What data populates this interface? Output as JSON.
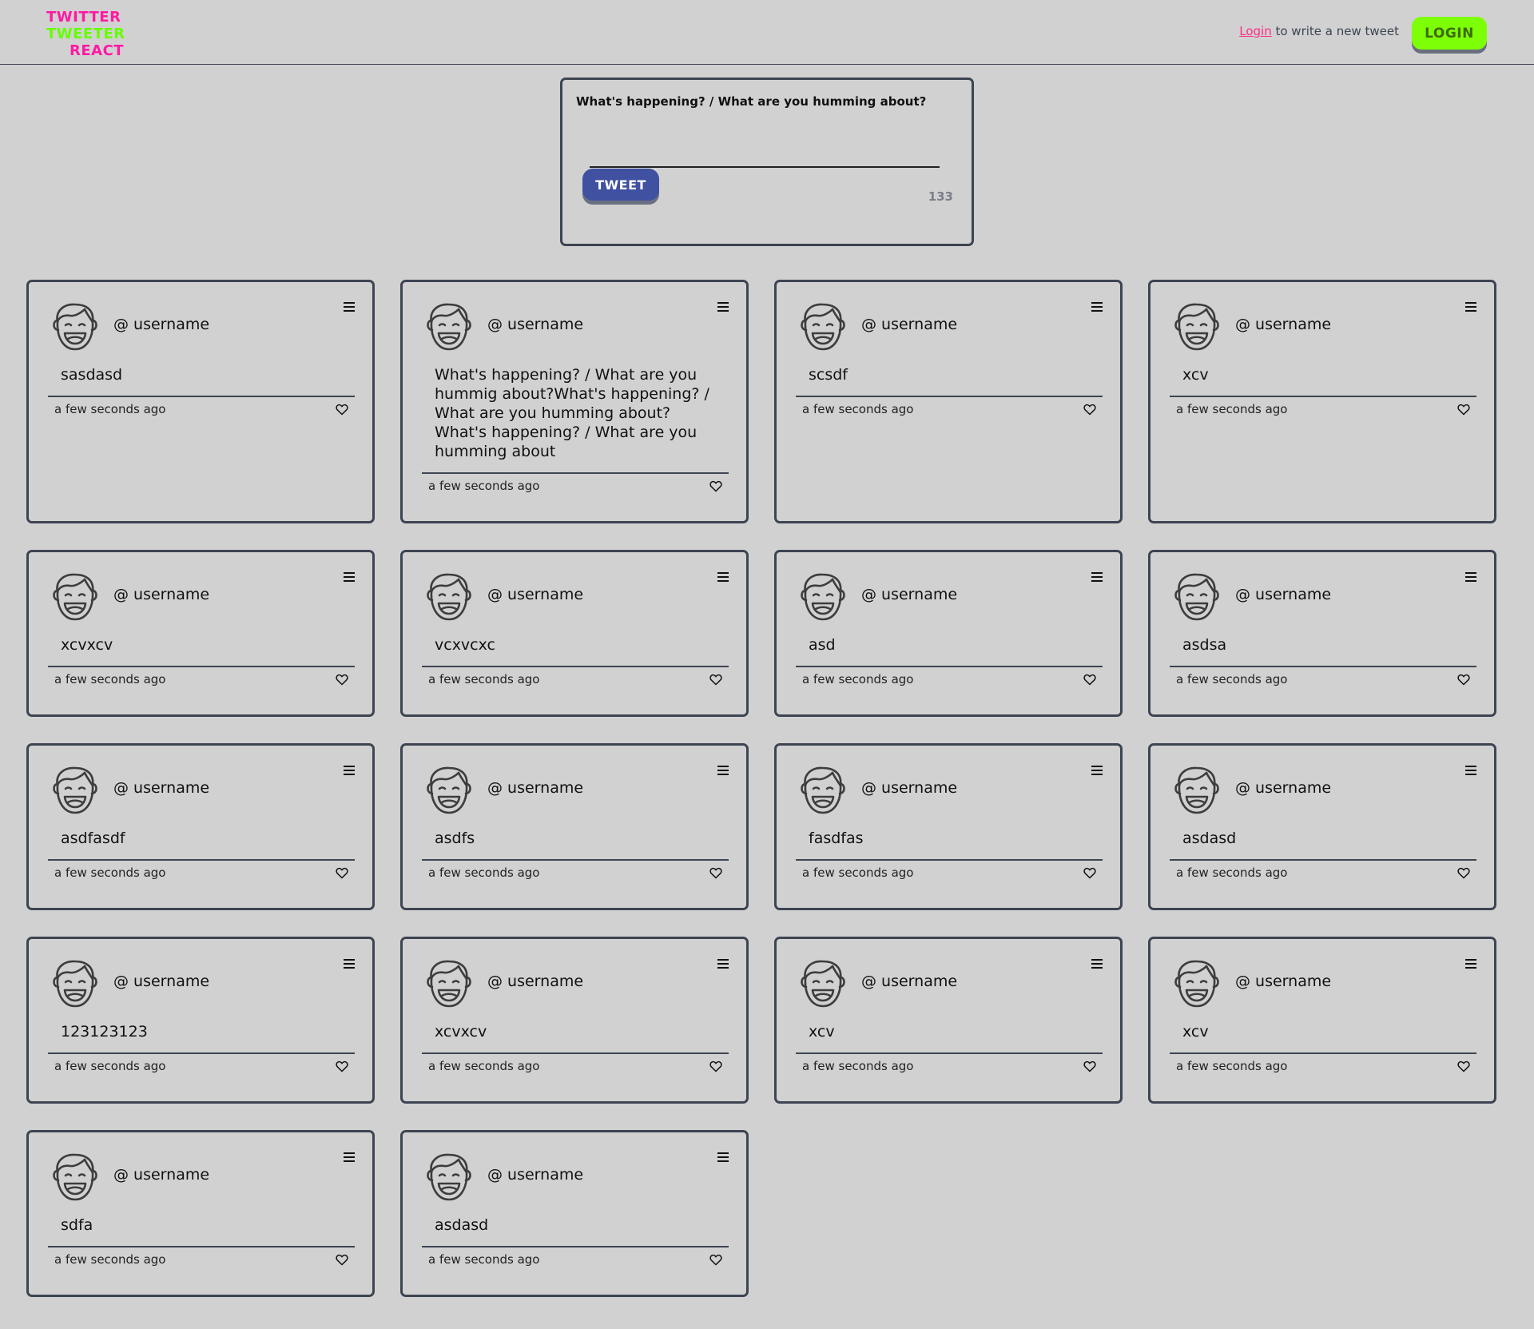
{
  "header": {
    "logo_lines": [
      "TWITTER",
      "TWEETER",
      "REACT"
    ],
    "login_link": "Login",
    "login_hint_rest": " to write a new tweet",
    "login_button": "LOGIN"
  },
  "composer": {
    "label": "What's happening? / What are you humming about?",
    "input_value": "",
    "tweet_button": "TWEET",
    "char_count": "133"
  },
  "tweets": [
    {
      "username": "@ username",
      "text": "sasdasd",
      "time": "a few seconds ago"
    },
    {
      "username": "@ username",
      "text": "What's happening? / What are you hummig about?What's happening? / What are you humming about?What's happening? / What are you humming about",
      "time": "a few seconds ago"
    },
    {
      "username": "@ username",
      "text": "scsdf",
      "time": "a few seconds ago"
    },
    {
      "username": "@ username",
      "text": "xcv",
      "time": "a few seconds ago"
    },
    {
      "username": "@ username",
      "text": "xcvxcv",
      "time": "a few seconds ago"
    },
    {
      "username": "@ username",
      "text": "vcxvcxc",
      "time": "a few seconds ago"
    },
    {
      "username": "@ username",
      "text": "asd",
      "time": "a few seconds ago"
    },
    {
      "username": "@ username",
      "text": "asdsa",
      "time": "a few seconds ago"
    },
    {
      "username": "@ username",
      "text": "asdfasdf",
      "time": "a few seconds ago"
    },
    {
      "username": "@ username",
      "text": "asdfs",
      "time": "a few seconds ago"
    },
    {
      "username": "@ username",
      "text": "fasdfas",
      "time": "a few seconds ago"
    },
    {
      "username": "@ username",
      "text": "asdasd",
      "time": "a few seconds ago"
    },
    {
      "username": "@ username",
      "text": "123123123",
      "time": "a few seconds ago"
    },
    {
      "username": "@ username",
      "text": "xcvxcv",
      "time": "a few seconds ago"
    },
    {
      "username": "@ username",
      "text": "xcv",
      "time": "a few seconds ago"
    },
    {
      "username": "@ username",
      "text": "xcv",
      "time": "a few seconds ago"
    },
    {
      "username": "@ username",
      "text": "sdfa",
      "time": "a few seconds ago"
    },
    {
      "username": "@ username",
      "text": "asdasd",
      "time": "a few seconds ago"
    }
  ],
  "icons": {
    "avatar": "smiling-face-avatar-icon",
    "menu": "hamburger-menu-icon",
    "like": "heart-icon"
  },
  "colors": {
    "background": "#d1d1d1",
    "border": "#3d4452",
    "logo_pink": "#ff1aa3",
    "logo_green": "#66ff00",
    "login_button": "#7dff07",
    "tweet_button": "#3f51a0",
    "link": "#ff2d87"
  }
}
